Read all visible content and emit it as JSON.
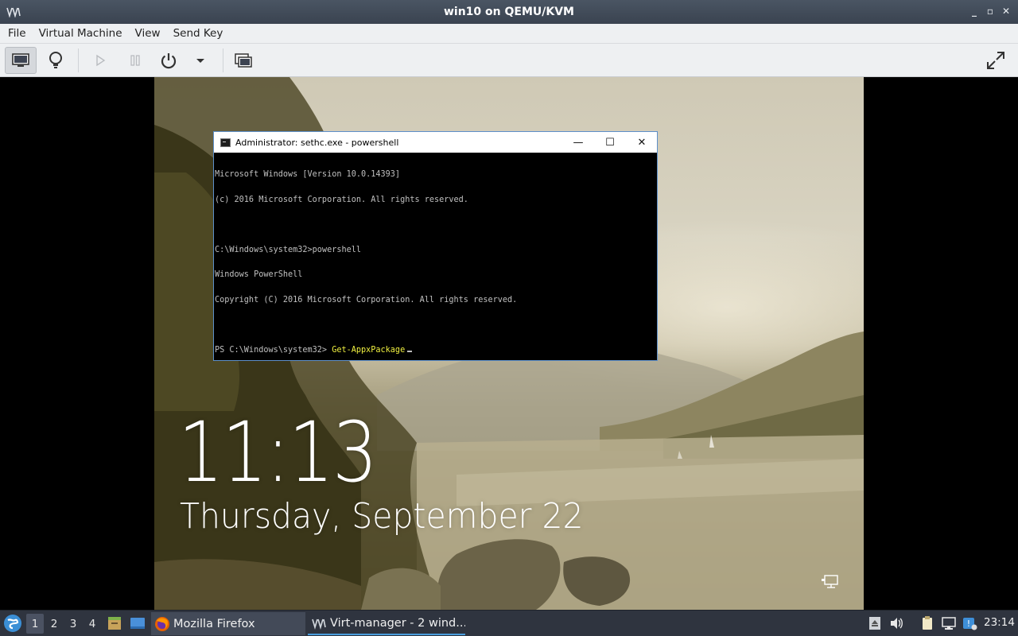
{
  "window": {
    "title": "win10 on QEMU/KVM",
    "buttons": [
      "_",
      "▫",
      "✕"
    ]
  },
  "menu": {
    "items": [
      "File",
      "Virtual Machine",
      "View",
      "Send Key"
    ]
  },
  "toolbar": {
    "buttons": [
      "monitor-icon",
      "lightbulb-icon",
      "play-icon",
      "pause-icon",
      "power-icon",
      "dropdown-icon",
      "snapshots-icon",
      "fullscreen-icon"
    ]
  },
  "lockscreen": {
    "time": "11:13",
    "date": "Thursday, September 22"
  },
  "console": {
    "title": "Administrator: sethc.exe - powershell",
    "lines": [
      "Microsoft Windows [Version 10.0.14393]",
      "(c) 2016 Microsoft Corporation. All rights reserved.",
      "",
      "C:\\Windows\\system32>powershell",
      "Windows PowerShell",
      "Copyright (C) 2016 Microsoft Corporation. All rights reserved.",
      ""
    ],
    "prompt": "PS C:\\Windows\\system32> ",
    "command": "Get-AppxPackage"
  },
  "taskbar": {
    "workspaces": [
      "1",
      "2",
      "3",
      "4"
    ],
    "active_workspace": "1",
    "tasks": [
      {
        "label": "Mozilla Firefox",
        "icon": "firefox-icon"
      },
      {
        "label": "Virt-manager - 2 wind...",
        "icon": "virt-manager-icon"
      }
    ],
    "clock": "23:14"
  },
  "colors": {
    "titlebar": "#3f4855",
    "taskbar": "#2f343f",
    "accent": "#4a9edd",
    "console_cmd": "#f0f040"
  }
}
